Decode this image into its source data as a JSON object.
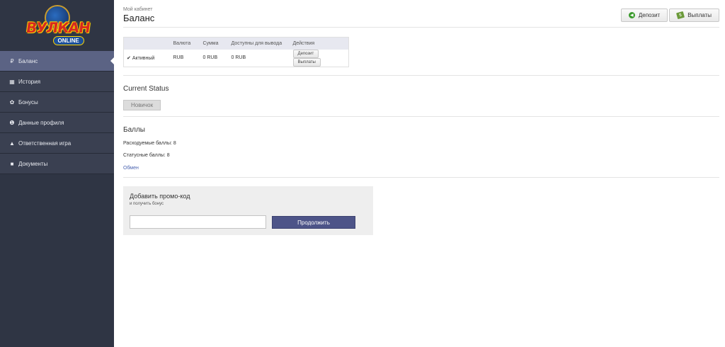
{
  "logo": {
    "word": "ВУЛКАН",
    "sub": "ONLINE"
  },
  "sidebar": {
    "items": [
      {
        "label": "Баланс",
        "icon": "ruble-icon",
        "glyph": "₽",
        "active": true
      },
      {
        "label": "История",
        "icon": "calendar-icon",
        "glyph": "▦"
      },
      {
        "label": "Бонусы",
        "icon": "gift-icon",
        "glyph": "✿"
      },
      {
        "label": "Данные профиля",
        "icon": "info-icon",
        "glyph": "❶"
      },
      {
        "label": "Ответственная игра",
        "icon": "lock-icon",
        "glyph": "▲"
      },
      {
        "label": "Документы",
        "icon": "folder-icon",
        "glyph": "■"
      }
    ]
  },
  "header": {
    "subtitle": "Мой кабинет",
    "title": "Баланс"
  },
  "top_buttons": {
    "deposit": "Депозит",
    "payouts": "Выплаты"
  },
  "balance_table": {
    "headers": [
      "",
      "Валюта",
      "Сумма",
      "Доступны для вывода",
      "Действия"
    ],
    "row": {
      "status": "Активный",
      "currency": "RUB",
      "amount": "0 RUB",
      "available": "0 RUB",
      "deposit_btn": "Депозит",
      "payout_btn": "Выплаты"
    }
  },
  "current_status": {
    "title": "Current Status",
    "badge": "Новичок"
  },
  "points": {
    "title": "Баллы",
    "spendable": "Расходуемые баллы: 8",
    "status": "Статусные баллы: 8",
    "exchange": "Обмен"
  },
  "promo": {
    "title": "Добавить промо-код",
    "subtitle": "и получить бонус",
    "input_value": "",
    "input_placeholder": "",
    "button": "Продолжить"
  },
  "colors": {
    "sidebar_bg": "#2f3544",
    "sidebar_active": "#5b6384",
    "accent_button": "#4d5488",
    "status_active": "#5aa02c",
    "link": "#4a63b0"
  }
}
